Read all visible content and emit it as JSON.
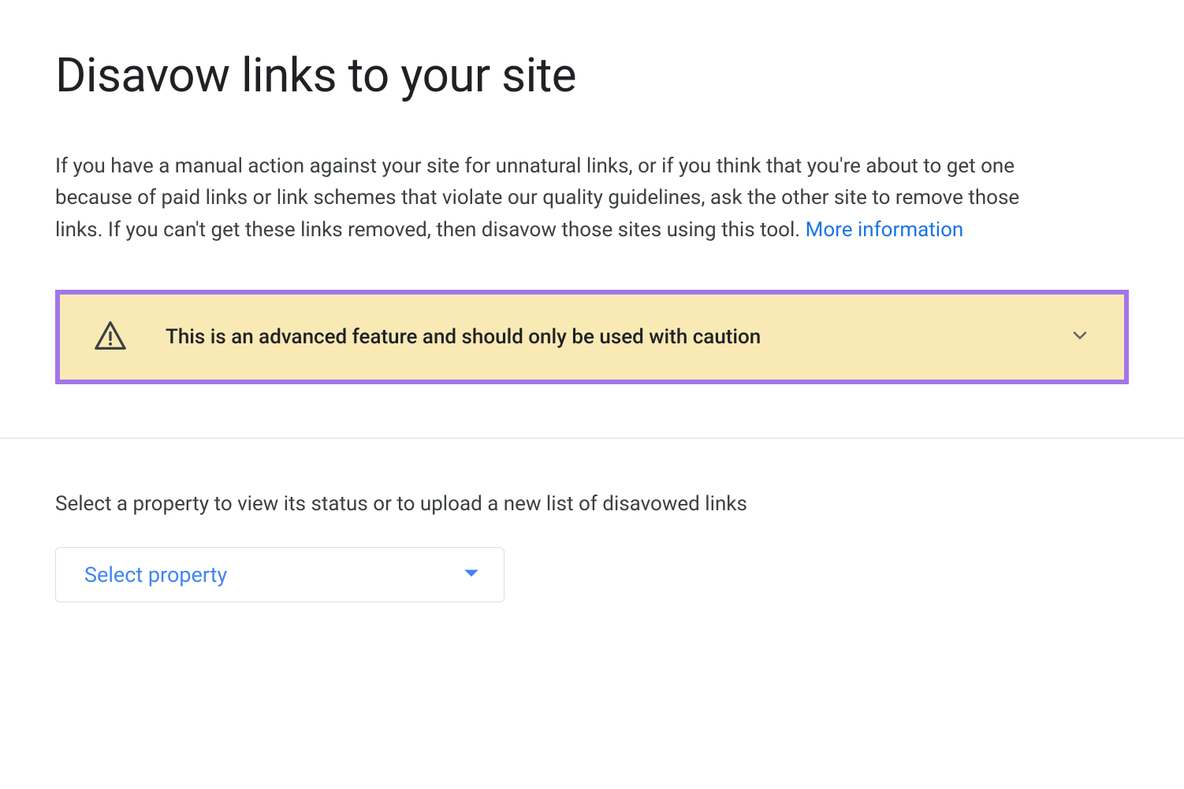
{
  "header": {
    "title": "Disavow links to your site"
  },
  "description": {
    "text": "If you have a manual action against your site for unnatural links, or if you think that you're about to get one because of paid links or link schemes that violate our quality guidelines, ask the other site to remove those links. If you can't get these links removed, then disavow those sites using this tool. ",
    "link_text": "More information"
  },
  "warning": {
    "text": "This is an advanced feature and should only be used with caution"
  },
  "select_section": {
    "label": "Select a property to view its status or to upload a new list of disavowed links",
    "dropdown_label": "Select property"
  },
  "colors": {
    "link": "#1a73e8",
    "banner_bg": "#f9e9b5",
    "banner_border": "#a374e8",
    "dropdown_text": "#4285f4"
  }
}
